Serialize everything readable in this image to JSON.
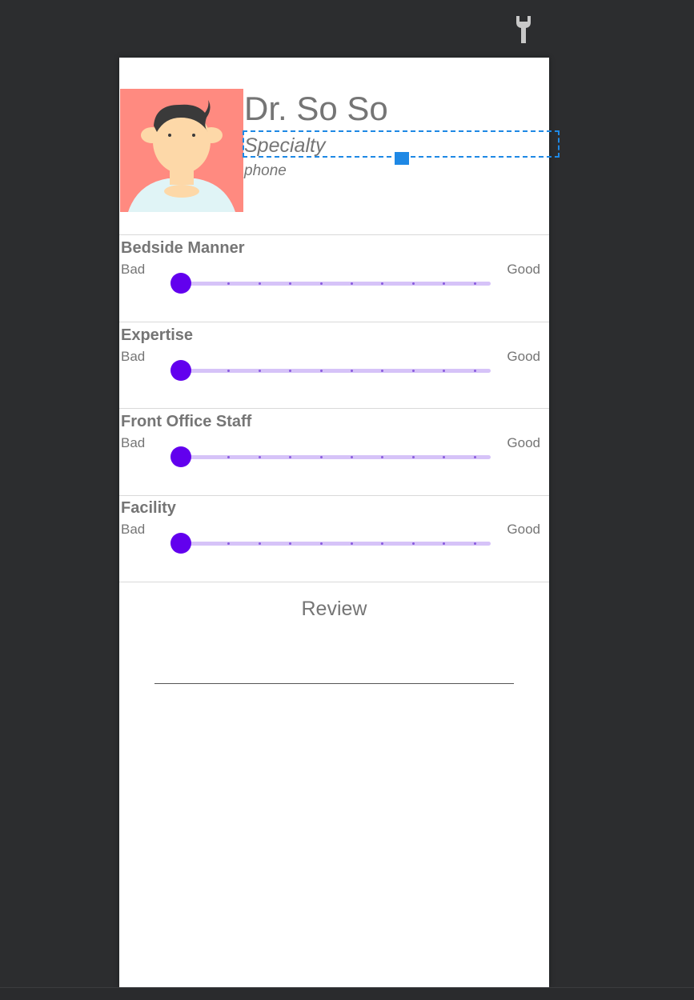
{
  "editor": {
    "toolbar_icon": "wrench-icon"
  },
  "profile": {
    "avatar_icon": "doctor-avatar-icon",
    "name": "Dr. So So",
    "specialty": "Specialty",
    "phone": "phone"
  },
  "ratings": [
    {
      "title": "Bedside Manner",
      "min_label": "Bad",
      "max_label": "Good",
      "value": 0,
      "max": 10
    },
    {
      "title": "Expertise",
      "min_label": "Bad",
      "max_label": "Good",
      "value": 0,
      "max": 10
    },
    {
      "title": "Front Office Staff",
      "min_label": "Bad",
      "max_label": "Good",
      "value": 0,
      "max": 10
    },
    {
      "title": "Facility",
      "min_label": "Bad",
      "max_label": "Good",
      "value": 0,
      "max": 10
    }
  ],
  "review": {
    "label": "Review",
    "value": ""
  },
  "colors": {
    "accent": "#6200ee",
    "track": "#d6c3f8",
    "text": "#757575",
    "selection": "#1e88e5",
    "avatar_bg": "#ff8a80"
  }
}
